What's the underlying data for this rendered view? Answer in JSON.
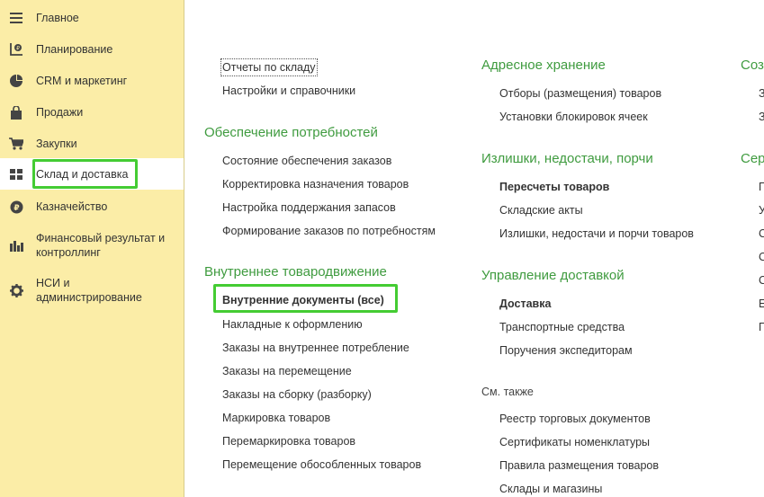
{
  "sidebar": {
    "items": [
      {
        "label": "Главное",
        "icon": "menu-icon"
      },
      {
        "label": "Планирование",
        "icon": "planning-icon"
      },
      {
        "label": "CRM и маркетинг",
        "icon": "pie-chart-icon"
      },
      {
        "label": "Продажи",
        "icon": "shopping-bag-icon"
      },
      {
        "label": "Закупки",
        "icon": "cart-icon"
      },
      {
        "label": "Склад и доставка",
        "icon": "warehouse-grid-icon"
      },
      {
        "label": "Казначейство",
        "icon": "ruble-coin-icon"
      },
      {
        "label": "Финансовый результат и",
        "label2": "контроллинг",
        "icon": "bar-chart-icon"
      },
      {
        "label": "НСИ и",
        "label2": "администрирование",
        "icon": "gear-icon"
      }
    ]
  },
  "col1": {
    "top_links": [
      "Отчеты по складу",
      "Настройки и справочники"
    ],
    "sec1": {
      "title": "Обеспечение потребностей",
      "links": [
        "Состояние обеспечения заказов",
        "Корректировка назначения товаров",
        "Настройка поддержания запасов",
        "Формирование заказов по потребностям"
      ]
    },
    "sec2": {
      "title": "Внутреннее товародвижение",
      "links": [
        "Внутренние документы (все)",
        "Накладные к оформлению",
        "Заказы на внутреннее потребление",
        "Заказы на перемещение",
        "Заказы на сборку (разборку)",
        "Маркировка товаров",
        "Перемаркировка товаров",
        "Перемещение обособленных товаров"
      ]
    }
  },
  "col2": {
    "sec1": {
      "title": "Адресное хранение",
      "links": [
        "Отборы (размещения) товаров",
        "Установки блокировок ячеек"
      ]
    },
    "sec2": {
      "title": "Излишки, недостачи, порчи",
      "links": [
        "Пересчеты товаров",
        "Складские акты",
        "Излишки, недостачи и порчи товаров"
      ]
    },
    "sec3": {
      "title": "Управление доставкой",
      "links": [
        "Доставка",
        "Транспортные средства",
        "Поручения экспедиторам"
      ]
    },
    "see_also": {
      "title": "См. также",
      "links": [
        "Реестр торговых документов",
        "Сертификаты номенклатуры",
        "Правила размещения товаров",
        "Склады и магазины"
      ]
    }
  },
  "col3": {
    "sec1": {
      "title": "Соз",
      "links": [
        "З",
        "З"
      ]
    },
    "sec2": {
      "title": "Сер",
      "links": [
        "П",
        "У",
        "С",
        "С",
        "С",
        "Е",
        "П"
      ]
    }
  },
  "colors": {
    "sidebar_bg": "#fbeda7",
    "section_title": "#3f9b3f",
    "highlight": "#44cc33"
  }
}
